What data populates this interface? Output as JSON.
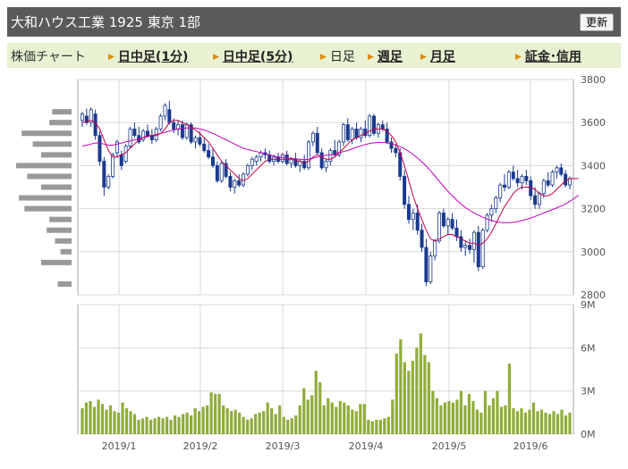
{
  "header": {
    "title": "大和ハウス工業  1925  東京 1部",
    "button_label": "更新"
  },
  "tabs": {
    "label": "株価チャート",
    "items": [
      {
        "label": "日中足(1分)",
        "link": true
      },
      {
        "label": "日中足(5分)",
        "link": true
      },
      {
        "label": "日足",
        "link": false
      },
      {
        "label": "週足",
        "link": true
      },
      {
        "label": "月足",
        "link": true
      },
      {
        "label": "証金･信用",
        "link": true
      }
    ]
  },
  "colors": {
    "up": "#1a3a8f",
    "down": "#1a3a8f",
    "ma_short": "#c0004a",
    "ma_long": "#c000c0",
    "volume": "#8fad3a",
    "volume_profile": "#999999"
  },
  "chart_data": [
    {
      "type": "candlestick",
      "title": "",
      "ylim": [
        2800,
        3800
      ],
      "y_ticks": [
        "3800",
        "3600",
        "3400",
        "3200",
        "3000",
        "2800"
      ],
      "x_tick_labels": [
        "2019/1",
        "2019/2",
        "2019/3",
        "2019/4",
        "2019/5",
        "2019/6"
      ],
      "grid": true,
      "candles": [
        {
          "o": 3610,
          "h": 3650,
          "l": 3580,
          "c": 3640
        },
        {
          "o": 3630,
          "h": 3665,
          "l": 3590,
          "c": 3600
        },
        {
          "o": 3600,
          "h": 3670,
          "l": 3580,
          "c": 3660
        },
        {
          "o": 3640,
          "h": 3660,
          "l": 3520,
          "c": 3540
        },
        {
          "o": 3540,
          "h": 3560,
          "l": 3400,
          "c": 3420
        },
        {
          "o": 3420,
          "h": 3440,
          "l": 3260,
          "c": 3300
        },
        {
          "o": 3300,
          "h": 3360,
          "l": 3290,
          "c": 3350
        },
        {
          "o": 3350,
          "h": 3460,
          "l": 3340,
          "c": 3450
        },
        {
          "o": 3460,
          "h": 3520,
          "l": 3440,
          "c": 3510
        },
        {
          "o": 3450,
          "h": 3470,
          "l": 3380,
          "c": 3400
        },
        {
          "o": 3420,
          "h": 3500,
          "l": 3410,
          "c": 3490
        },
        {
          "o": 3490,
          "h": 3580,
          "l": 3480,
          "c": 3570
        },
        {
          "o": 3570,
          "h": 3600,
          "l": 3530,
          "c": 3540
        },
        {
          "o": 3540,
          "h": 3580,
          "l": 3500,
          "c": 3510
        },
        {
          "o": 3520,
          "h": 3570,
          "l": 3510,
          "c": 3560
        },
        {
          "o": 3560,
          "h": 3590,
          "l": 3530,
          "c": 3540
        },
        {
          "o": 3540,
          "h": 3570,
          "l": 3500,
          "c": 3520
        },
        {
          "o": 3520,
          "h": 3580,
          "l": 3510,
          "c": 3570
        },
        {
          "o": 3570,
          "h": 3640,
          "l": 3560,
          "c": 3630
        },
        {
          "o": 3630,
          "h": 3690,
          "l": 3610,
          "c": 3680
        },
        {
          "o": 3660,
          "h": 3700,
          "l": 3590,
          "c": 3600
        },
        {
          "o": 3600,
          "h": 3620,
          "l": 3550,
          "c": 3570
        },
        {
          "o": 3570,
          "h": 3610,
          "l": 3540,
          "c": 3590
        },
        {
          "o": 3590,
          "h": 3610,
          "l": 3520,
          "c": 3530
        },
        {
          "o": 3530,
          "h": 3600,
          "l": 3520,
          "c": 3590
        },
        {
          "o": 3590,
          "h": 3600,
          "l": 3500,
          "c": 3510
        },
        {
          "o": 3510,
          "h": 3540,
          "l": 3480,
          "c": 3530
        },
        {
          "o": 3530,
          "h": 3560,
          "l": 3490,
          "c": 3500
        },
        {
          "o": 3500,
          "h": 3530,
          "l": 3460,
          "c": 3470
        },
        {
          "o": 3470,
          "h": 3500,
          "l": 3430,
          "c": 3440
        },
        {
          "o": 3440,
          "h": 3480,
          "l": 3390,
          "c": 3400
        },
        {
          "o": 3400,
          "h": 3420,
          "l": 3320,
          "c": 3330
        },
        {
          "o": 3330,
          "h": 3420,
          "l": 3320,
          "c": 3410
        },
        {
          "o": 3410,
          "h": 3430,
          "l": 3340,
          "c": 3350
        },
        {
          "o": 3350,
          "h": 3370,
          "l": 3280,
          "c": 3300
        },
        {
          "o": 3300,
          "h": 3340,
          "l": 3270,
          "c": 3330
        },
        {
          "o": 3330,
          "h": 3360,
          "l": 3300,
          "c": 3310
        },
        {
          "o": 3310,
          "h": 3370,
          "l": 3300,
          "c": 3360
        },
        {
          "o": 3360,
          "h": 3410,
          "l": 3350,
          "c": 3400
        },
        {
          "o": 3400,
          "h": 3440,
          "l": 3380,
          "c": 3430
        },
        {
          "o": 3420,
          "h": 3450,
          "l": 3400,
          "c": 3440
        },
        {
          "o": 3440,
          "h": 3470,
          "l": 3420,
          "c": 3460
        },
        {
          "o": 3460,
          "h": 3480,
          "l": 3430,
          "c": 3450
        },
        {
          "o": 3450,
          "h": 3470,
          "l": 3410,
          "c": 3420
        },
        {
          "o": 3420,
          "h": 3450,
          "l": 3400,
          "c": 3440
        },
        {
          "o": 3440,
          "h": 3460,
          "l": 3410,
          "c": 3420
        },
        {
          "o": 3420,
          "h": 3460,
          "l": 3410,
          "c": 3450
        },
        {
          "o": 3450,
          "h": 3470,
          "l": 3400,
          "c": 3410
        },
        {
          "o": 3410,
          "h": 3440,
          "l": 3390,
          "c": 3430
        },
        {
          "o": 3430,
          "h": 3460,
          "l": 3390,
          "c": 3400
        },
        {
          "o": 3400,
          "h": 3430,
          "l": 3370,
          "c": 3420
        },
        {
          "o": 3420,
          "h": 3450,
          "l": 3380,
          "c": 3390
        },
        {
          "o": 3390,
          "h": 3520,
          "l": 3380,
          "c": 3510
        },
        {
          "o": 3510,
          "h": 3560,
          "l": 3490,
          "c": 3550
        },
        {
          "o": 3550,
          "h": 3580,
          "l": 3450,
          "c": 3460
        },
        {
          "o": 3460,
          "h": 3480,
          "l": 3380,
          "c": 3390
        },
        {
          "o": 3390,
          "h": 3430,
          "l": 3370,
          "c": 3420
        },
        {
          "o": 3420,
          "h": 3480,
          "l": 3400,
          "c": 3470
        },
        {
          "o": 3470,
          "h": 3520,
          "l": 3440,
          "c": 3450
        },
        {
          "o": 3450,
          "h": 3520,
          "l": 3440,
          "c": 3510
        },
        {
          "o": 3510,
          "h": 3600,
          "l": 3490,
          "c": 3590
        },
        {
          "o": 3590,
          "h": 3620,
          "l": 3510,
          "c": 3520
        },
        {
          "o": 3520,
          "h": 3580,
          "l": 3500,
          "c": 3570
        },
        {
          "o": 3570,
          "h": 3600,
          "l": 3520,
          "c": 3530
        },
        {
          "o": 3530,
          "h": 3580,
          "l": 3510,
          "c": 3570
        },
        {
          "o": 3570,
          "h": 3610,
          "l": 3530,
          "c": 3540
        },
        {
          "o": 3540,
          "h": 3640,
          "l": 3530,
          "c": 3630
        },
        {
          "o": 3630,
          "h": 3640,
          "l": 3540,
          "c": 3550
        },
        {
          "o": 3550,
          "h": 3600,
          "l": 3530,
          "c": 3590
        },
        {
          "o": 3590,
          "h": 3610,
          "l": 3560,
          "c": 3570
        },
        {
          "o": 3570,
          "h": 3600,
          "l": 3500,
          "c": 3510
        },
        {
          "o": 3510,
          "h": 3530,
          "l": 3460,
          "c": 3480
        },
        {
          "o": 3480,
          "h": 3500,
          "l": 3440,
          "c": 3460
        },
        {
          "o": 3460,
          "h": 3480,
          "l": 3330,
          "c": 3350
        },
        {
          "o": 3350,
          "h": 3380,
          "l": 3200,
          "c": 3220
        },
        {
          "o": 3220,
          "h": 3260,
          "l": 3130,
          "c": 3150
        },
        {
          "o": 3150,
          "h": 3200,
          "l": 3100,
          "c": 3180
        },
        {
          "o": 3180,
          "h": 3220,
          "l": 3080,
          "c": 3100
        },
        {
          "o": 3100,
          "h": 3130,
          "l": 3000,
          "c": 3020
        },
        {
          "o": 3020,
          "h": 3060,
          "l": 2840,
          "c": 2860
        },
        {
          "o": 2860,
          "h": 3000,
          "l": 2850,
          "c": 2980
        },
        {
          "o": 2980,
          "h": 3060,
          "l": 2960,
          "c": 3050
        },
        {
          "o": 3050,
          "h": 3190,
          "l": 3040,
          "c": 3180
        },
        {
          "o": 3180,
          "h": 3200,
          "l": 3110,
          "c": 3120
        },
        {
          "o": 3120,
          "h": 3160,
          "l": 3080,
          "c": 3150
        },
        {
          "o": 3150,
          "h": 3180,
          "l": 3100,
          "c": 3110
        },
        {
          "o": 3110,
          "h": 3150,
          "l": 3050,
          "c": 3070
        },
        {
          "o": 3070,
          "h": 3100,
          "l": 3000,
          "c": 3020
        },
        {
          "o": 3020,
          "h": 3050,
          "l": 2980,
          "c": 3030
        },
        {
          "o": 3030,
          "h": 3060,
          "l": 2990,
          "c": 3010
        },
        {
          "o": 3010,
          "h": 3100,
          "l": 2950,
          "c": 3090
        },
        {
          "o": 3090,
          "h": 3120,
          "l": 2910,
          "c": 2930
        },
        {
          "o": 2930,
          "h": 3110,
          "l": 2920,
          "c": 3100
        },
        {
          "o": 3100,
          "h": 3180,
          "l": 3090,
          "c": 3170
        },
        {
          "o": 3170,
          "h": 3220,
          "l": 3140,
          "c": 3200
        },
        {
          "o": 3200,
          "h": 3260,
          "l": 3180,
          "c": 3250
        },
        {
          "o": 3250,
          "h": 3320,
          "l": 3230,
          "c": 3310
        },
        {
          "o": 3310,
          "h": 3360,
          "l": 3280,
          "c": 3300
        },
        {
          "o": 3300,
          "h": 3380,
          "l": 3290,
          "c": 3370
        },
        {
          "o": 3370,
          "h": 3400,
          "l": 3330,
          "c": 3340
        },
        {
          "o": 3340,
          "h": 3380,
          "l": 3300,
          "c": 3320
        },
        {
          "o": 3320,
          "h": 3360,
          "l": 3290,
          "c": 3350
        },
        {
          "o": 3350,
          "h": 3380,
          "l": 3310,
          "c": 3330
        },
        {
          "o": 3330,
          "h": 3350,
          "l": 3240,
          "c": 3260
        },
        {
          "o": 3260,
          "h": 3300,
          "l": 3200,
          "c": 3220
        },
        {
          "o": 3220,
          "h": 3280,
          "l": 3200,
          "c": 3270
        },
        {
          "o": 3270,
          "h": 3340,
          "l": 3250,
          "c": 3330
        },
        {
          "o": 3330,
          "h": 3370,
          "l": 3300,
          "c": 3310
        },
        {
          "o": 3310,
          "h": 3380,
          "l": 3300,
          "c": 3370
        },
        {
          "o": 3370,
          "h": 3400,
          "l": 3340,
          "c": 3390
        },
        {
          "o": 3390,
          "h": 3410,
          "l": 3350,
          "c": 3360
        },
        {
          "o": 3360,
          "h": 3380,
          "l": 3300,
          "c": 3310
        },
        {
          "o": 3310,
          "h": 3350,
          "l": 3290,
          "c": 3340
        }
      ],
      "ma_short": [
        3600,
        3605,
        3610,
        3600,
        3570,
        3520,
        3470,
        3440,
        3440,
        3450,
        3460,
        3480,
        3500,
        3520,
        3530,
        3540,
        3540,
        3540,
        3550,
        3570,
        3600,
        3610,
        3610,
        3600,
        3590,
        3580,
        3565,
        3550,
        3530,
        3510,
        3480,
        3450,
        3420,
        3400,
        3380,
        3360,
        3340,
        3330,
        3340,
        3360,
        3380,
        3400,
        3420,
        3430,
        3430,
        3430,
        3430,
        3430,
        3430,
        3425,
        3420,
        3415,
        3420,
        3440,
        3450,
        3440,
        3430,
        3430,
        3440,
        3460,
        3480,
        3500,
        3520,
        3530,
        3540,
        3550,
        3560,
        3570,
        3570,
        3570,
        3560,
        3540,
        3510,
        3460,
        3400,
        3330,
        3260,
        3200,
        3150,
        3100,
        3060,
        3050,
        3060,
        3070,
        3080,
        3080,
        3070,
        3060,
        3050,
        3040,
        3040,
        3030,
        3040,
        3060,
        3090,
        3130,
        3170,
        3210,
        3240,
        3270,
        3290,
        3300,
        3300,
        3300,
        3290,
        3270,
        3260,
        3260,
        3270,
        3290,
        3310,
        3330,
        3340,
        3340,
        3340
      ],
      "ma_long": [
        3490,
        3495,
        3500,
        3505,
        3505,
        3500,
        3495,
        3495,
        3500,
        3505,
        3510,
        3515,
        3520,
        3525,
        3530,
        3535,
        3540,
        3545,
        3550,
        3555,
        3560,
        3565,
        3570,
        3572,
        3575,
        3575,
        3575,
        3570,
        3565,
        3558,
        3550,
        3540,
        3530,
        3520,
        3510,
        3500,
        3490,
        3480,
        3475,
        3470,
        3465,
        3460,
        3455,
        3450,
        3445,
        3440,
        3438,
        3436,
        3434,
        3432,
        3430,
        3428,
        3430,
        3435,
        3440,
        3445,
        3448,
        3450,
        3455,
        3460,
        3465,
        3470,
        3478,
        3485,
        3492,
        3498,
        3503,
        3506,
        3508,
        3508,
        3506,
        3502,
        3496,
        3488,
        3478,
        3466,
        3452,
        3436,
        3418,
        3398,
        3376,
        3352,
        3328,
        3304,
        3280,
        3260,
        3240,
        3222,
        3206,
        3192,
        3180,
        3170,
        3160,
        3152,
        3145,
        3140,
        3136,
        3135,
        3135,
        3137,
        3140,
        3145,
        3150,
        3157,
        3164,
        3172,
        3180,
        3188,
        3196,
        3204,
        3212,
        3222,
        3234,
        3248,
        3262
      ]
    },
    {
      "type": "bar",
      "title": "",
      "ylim": [
        0,
        9
      ],
      "y_ticks": [
        "9M",
        "6M",
        "3M",
        "0M"
      ],
      "x_tick_labels": [
        "2019/1",
        "2019/2",
        "2019/3",
        "2019/4",
        "2019/5",
        "2019/6"
      ],
      "values_millions": [
        1.8,
        2.2,
        2.3,
        1.9,
        2.4,
        2.1,
        1.7,
        2.0,
        1.6,
        1.5,
        2.2,
        1.8,
        1.6,
        1.4,
        1.0,
        1.1,
        1.2,
        1.0,
        1.1,
        1.2,
        1.1,
        1.2,
        1.0,
        1.3,
        1.2,
        1.4,
        1.5,
        1.3,
        1.8,
        1.6,
        1.9,
        2.0,
        2.9,
        2.8,
        2.8,
        2.0,
        1.8,
        1.6,
        1.7,
        1.5,
        1.2,
        1.0,
        1.1,
        1.4,
        1.5,
        1.6,
        2.2,
        1.8,
        1.4,
        2.0,
        1.2,
        1.0,
        1.1,
        1.3,
        2.0,
        3.2,
        2.4,
        2.7,
        4.4,
        3.6,
        2.0,
        2.5,
        2.2,
        1.9,
        2.3,
        2.2,
        2.0,
        1.7,
        1.6,
        2.1,
        2.1,
        1.0,
        0.9,
        1.0,
        1.0,
        1.1,
        1.2,
        2.4,
        5.6,
        6.6,
        5.0,
        4.4,
        5.1,
        6.0,
        7.0,
        5.5,
        5.0,
        3.0,
        2.5,
        2.0,
        2.2,
        2.3,
        2.2,
        2.4,
        3.0,
        2.0,
        2.8,
        2.3,
        1.7,
        1.5,
        3.0,
        2.0,
        2.5,
        3.0,
        1.9,
        2.0,
        4.9,
        1.8,
        1.6,
        1.8,
        1.5,
        1.7,
        2.2,
        1.6,
        1.7,
        1.5,
        1.4,
        1.6,
        1.4,
        1.7,
        1.3,
        1.5
      ]
    },
    {
      "type": "volume_profile",
      "title": "",
      "price_levels": [
        3650,
        3600,
        3550,
        3500,
        3450,
        3400,
        3350,
        3300,
        3250,
        3200,
        3150,
        3100,
        3050,
        3000,
        2950,
        2850
      ],
      "values": [
        0.35,
        0.4,
        0.9,
        0.7,
        0.55,
        1.0,
        0.8,
        0.55,
        0.95,
        0.85,
        0.4,
        0.45,
        0.3,
        0.2,
        0.55,
        0.25
      ]
    }
  ]
}
